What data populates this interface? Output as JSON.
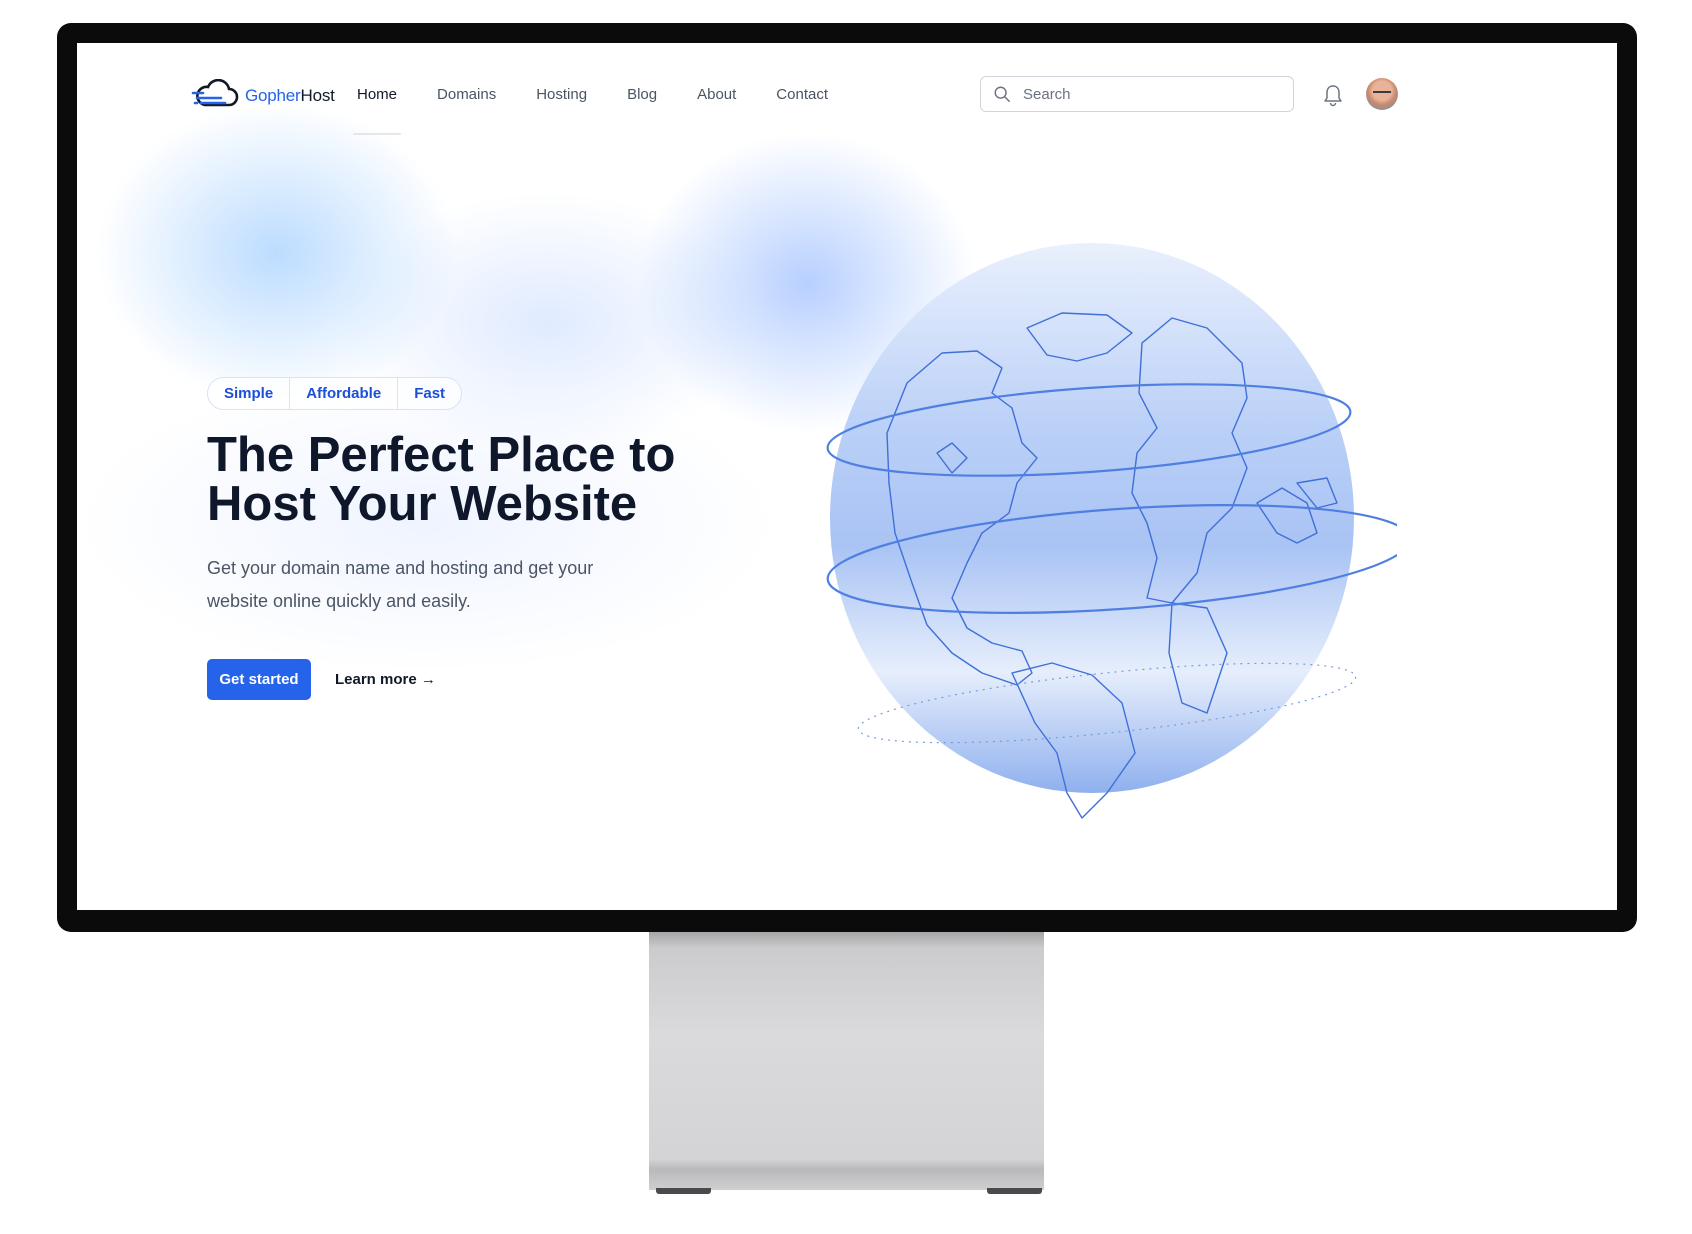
{
  "brand": {
    "name_part1": "Gopher",
    "name_part2": "Host",
    "accent_color": "#2563eb"
  },
  "nav": {
    "items": [
      {
        "label": "Home",
        "active": true
      },
      {
        "label": "Domains"
      },
      {
        "label": "Hosting"
      },
      {
        "label": "Blog"
      },
      {
        "label": "About"
      },
      {
        "label": "Contact"
      }
    ]
  },
  "search": {
    "placeholder": "Search",
    "icon": "search-icon"
  },
  "header_icons": {
    "notifications": "bell-icon",
    "profile": "avatar"
  },
  "hero": {
    "tags": [
      "Simple",
      "Affordable",
      "Fast"
    ],
    "title_line1": "The Perfect Place to",
    "title_line2": "Host Your Website",
    "subtitle": "Get your domain name and hosting and get your website online quickly and easily.",
    "primary_cta": "Get started",
    "secondary_cta": "Learn more →"
  },
  "illustration": {
    "icon": "globe-icon"
  }
}
